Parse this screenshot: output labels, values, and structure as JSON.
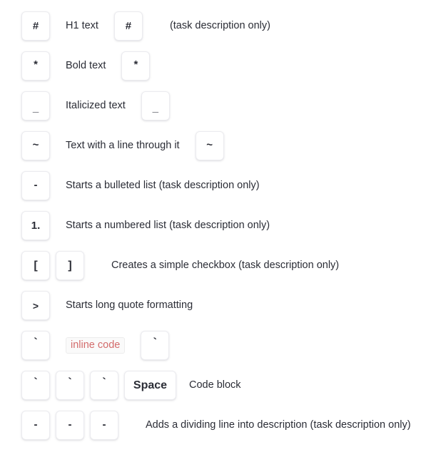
{
  "rows": [
    {
      "name": "h1",
      "key1": "#",
      "label": "H1 text",
      "key2": "#",
      "trailing": "(task description only)"
    },
    {
      "name": "bold",
      "key1": "*",
      "label": "Bold text",
      "key2": "*",
      "trailing": ""
    },
    {
      "name": "italic",
      "key1": "_",
      "label": "Italicized text",
      "key2": "_",
      "trailing": ""
    },
    {
      "name": "strikethrough",
      "key1": "~",
      "label": "Text with a line through it",
      "key2": "~",
      "trailing": ""
    },
    {
      "name": "bulleted-list",
      "key1": "-",
      "label": "Starts a bulleted list (task description only)"
    },
    {
      "name": "numbered-list",
      "key1": "1.",
      "label": "Starts a numbered list (task description only)"
    },
    {
      "name": "checkbox",
      "key1": "[",
      "key2": "]",
      "label": "Creates a simple checkbox (task description only)"
    },
    {
      "name": "blockquote",
      "key1": ">",
      "label": "Starts long quote formatting"
    },
    {
      "name": "inline-code",
      "key1": "`",
      "code_chip": "inline code",
      "key2": "`"
    },
    {
      "name": "code-block",
      "key1": "`",
      "key2": "`",
      "key3": "`",
      "key4": "Space",
      "label": "Code block"
    },
    {
      "name": "divider",
      "key1": "-",
      "key2": "-",
      "key3": "-",
      "label": "Adds a dividing line into description (task description only)"
    }
  ],
  "colors": {
    "background": "#ffffff",
    "text": "#2b2d36",
    "key_border": "#ebebef",
    "code_text": "#d36b6b",
    "code_background": "#fafafa",
    "code_border": "#ececec"
  }
}
